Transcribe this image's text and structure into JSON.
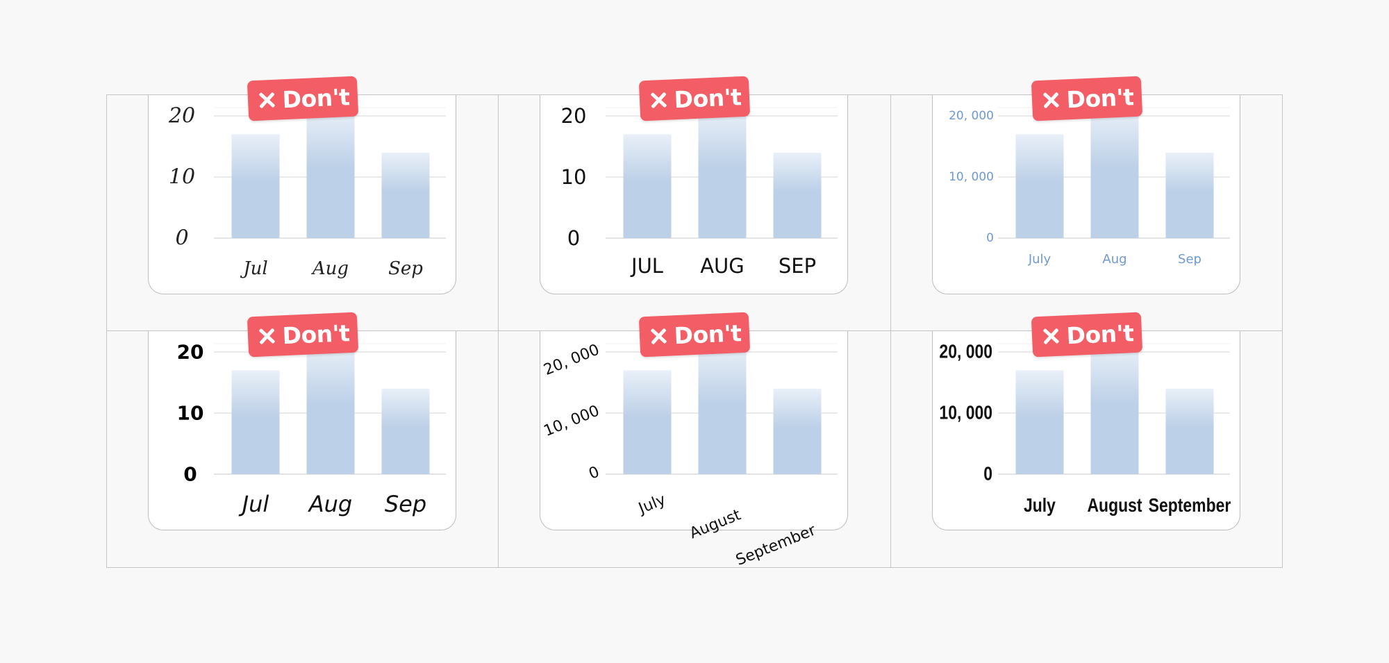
{
  "badge": {
    "label": "Don't",
    "icon": "close-icon"
  },
  "colors": {
    "bar": "#bcd0e7",
    "bar_top": "#e9f0f8",
    "badge": "#f25d66",
    "grid": "#e4e4e4",
    "blue_text": "#6e9ad0"
  },
  "chart_data": [
    {
      "type": "bar",
      "style": "script-font",
      "categories": [
        "Jul",
        "Aug",
        "Sep"
      ],
      "values": [
        17,
        21,
        14
      ],
      "yticks": [
        "0",
        "10",
        "20"
      ],
      "ylim": [
        0,
        20
      ],
      "grid": true
    },
    {
      "type": "bar",
      "style": "uppercase",
      "categories": [
        "JUL",
        "AUG",
        "SEP"
      ],
      "values": [
        17,
        21,
        14
      ],
      "yticks": [
        "0",
        "10",
        "20"
      ],
      "ylim": [
        0,
        20
      ],
      "grid": true
    },
    {
      "type": "bar",
      "style": "light-blue-labels",
      "categories": [
        "July",
        "Aug",
        "Sep"
      ],
      "values": [
        17000,
        21000,
        14000
      ],
      "yticks": [
        "0",
        "10, 000",
        "20, 000"
      ],
      "ylim": [
        0,
        20000
      ],
      "grid": true
    },
    {
      "type": "bar",
      "style": "heavy-axis-italic-categories",
      "categories": [
        "Jul",
        "Aug",
        "Sep"
      ],
      "values": [
        17,
        21,
        14
      ],
      "yticks": [
        "0",
        "10",
        "20"
      ],
      "ylim": [
        0,
        20
      ],
      "grid": true
    },
    {
      "type": "bar",
      "style": "rotated-labels",
      "categories": [
        "July",
        "August",
        "September"
      ],
      "values": [
        17000,
        21000,
        14000
      ],
      "yticks": [
        "0",
        "10, 000",
        "20, 000"
      ],
      "ylim": [
        0,
        20000
      ],
      "grid": true
    },
    {
      "type": "bar",
      "style": "condensed-bold",
      "categories": [
        "July",
        "August",
        "September"
      ],
      "values": [
        17000,
        21000,
        14000
      ],
      "yticks": [
        "0",
        "10, 000",
        "20, 000"
      ],
      "ylim": [
        0,
        20000
      ],
      "grid": true
    }
  ]
}
